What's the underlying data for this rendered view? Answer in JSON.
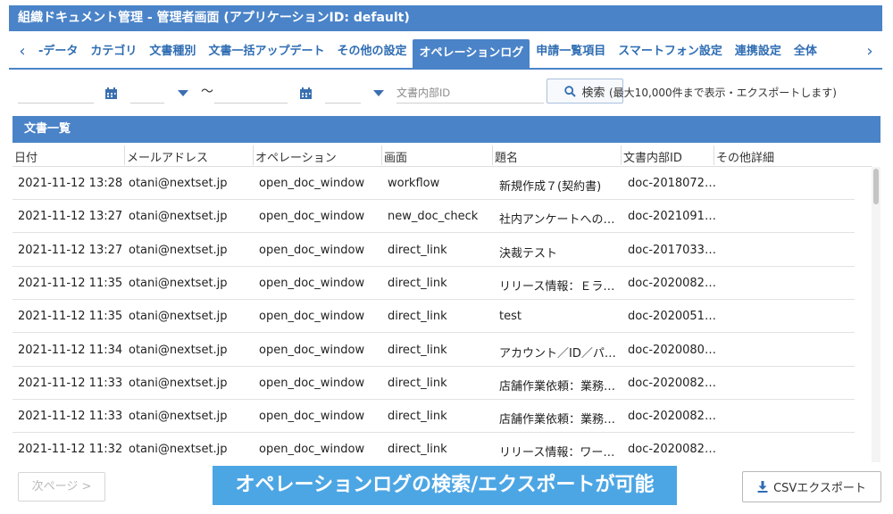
{
  "window": {
    "title": "組織ドキュメント管理 - 管理者画面 (アプリケーションID: default)"
  },
  "tabs": [
    {
      "label": "-データ",
      "active": false
    },
    {
      "label": "カテゴリ",
      "active": false
    },
    {
      "label": "文書種別",
      "active": false
    },
    {
      "label": "文書一括アップデート",
      "active": false
    },
    {
      "label": "その他の設定",
      "active": false
    },
    {
      "label": "オペレーションログ",
      "active": true
    },
    {
      "label": "申請一覧項目",
      "active": false
    },
    {
      "label": "スマートフォン設定",
      "active": false
    },
    {
      "label": "連携設定",
      "active": false
    },
    {
      "label": "全体",
      "active": false
    }
  ],
  "search": {
    "date_from": "",
    "date_to": "",
    "range_separator": "〜",
    "doc_id_placeholder": "文書内部ID",
    "button_label": "検索",
    "note": "(最大10,000件まで表示・エクスポートします)"
  },
  "panel": {
    "title": "文書一覧"
  },
  "table": {
    "columns": [
      "日付",
      "メールアドレス",
      "オペレーション",
      "画面",
      "題名",
      "文書内部ID",
      "その他詳細"
    ],
    "rows": [
      [
        "2021-11-12 13:28",
        "otani@nextset.jp",
        "open_doc_window",
        "workflow",
        "新規作成７(契約書)",
        "doc-2018072…",
        ""
      ],
      [
        "2021-11-12 13:27",
        "otani@nextset.jp",
        "open_doc_window",
        "new_doc_check",
        "社内アンケートへの…",
        "doc-2021091…",
        ""
      ],
      [
        "2021-11-12 13:27",
        "otani@nextset.jp",
        "open_doc_window",
        "direct_link",
        "決裁テスト",
        "doc-2017033…",
        ""
      ],
      [
        "2021-11-12 11:35",
        "otani@nextset.jp",
        "open_doc_window",
        "direct_link",
        "リリース情報：Ｅラ…",
        "doc-2020082…",
        ""
      ],
      [
        "2021-11-12 11:35",
        "otani@nextset.jp",
        "open_doc_window",
        "direct_link",
        "test",
        "doc-2020051…",
        ""
      ],
      [
        "2021-11-12 11:34",
        "otani@nextset.jp",
        "open_doc_window",
        "direct_link",
        "アカウント／ID／パ…",
        "doc-2020080…",
        ""
      ],
      [
        "2021-11-12 11:33",
        "otani@nextset.jp",
        "open_doc_window",
        "direct_link",
        "店舗作業依頼：業務…",
        "doc-2020082…",
        ""
      ],
      [
        "2021-11-12 11:33",
        "otani@nextset.jp",
        "open_doc_window",
        "direct_link",
        "店舗作業依頼：業務…",
        "doc-2020082…",
        ""
      ],
      [
        "2021-11-12 11:32",
        "otani@nextset.jp",
        "open_doc_window",
        "direct_link",
        "リリース情報：ワー…",
        "doc-2020082…",
        ""
      ]
    ]
  },
  "footer": {
    "next_label": "次ページ >",
    "banner": "オペレーションログの検索/エクスポートが可能",
    "csv_label": "CSVエクスポート"
  },
  "colors": {
    "accent": "#4a83c8",
    "link": "#2f6db3",
    "banner": "#4da6e4"
  },
  "icons": [
    "chevron-left-icon",
    "chevron-right-icon",
    "calendar-icon",
    "caret-down-icon",
    "search-icon",
    "download-icon"
  ]
}
